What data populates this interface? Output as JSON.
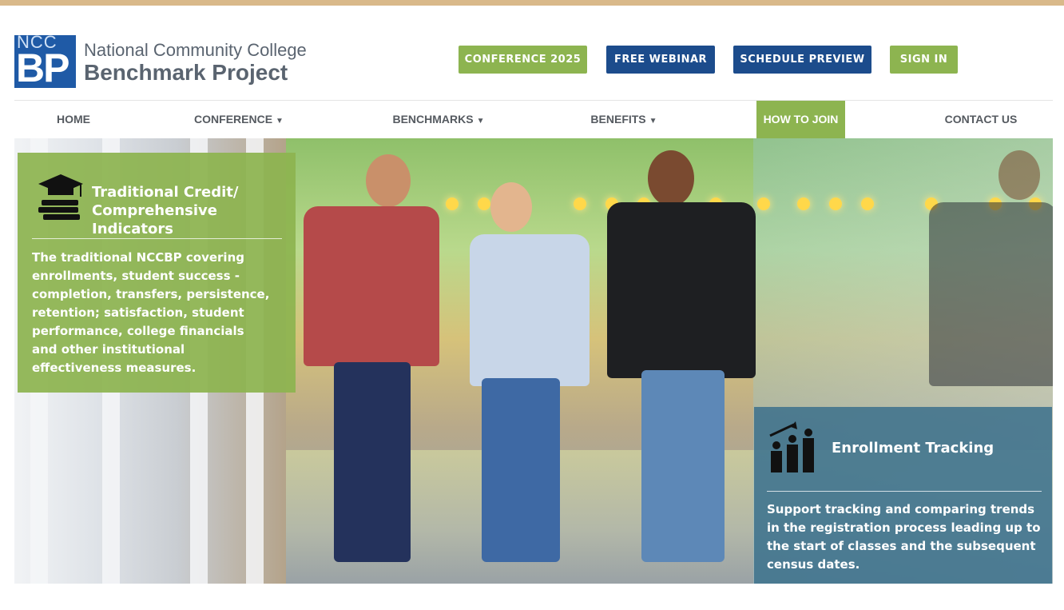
{
  "logo": {
    "mark_top": "NCC",
    "mark_bottom": "BP",
    "line1": "National Community College",
    "line2": "Benchmark Project"
  },
  "top_buttons": {
    "conference": "CONFERENCE 2025",
    "webinar": "FREE WEBINAR",
    "schedule": "SCHEDULE PREVIEW",
    "signin": "SIGN IN"
  },
  "nav": {
    "home": "HOME",
    "conference": "CONFERENCE",
    "benchmarks": "BENCHMARKS",
    "benefits": "BENEFITS",
    "how_to_join": "HOW TO JOIN",
    "contact": "CONTACT US"
  },
  "cards": {
    "left": {
      "icon": "graduation-cap-books-icon",
      "title_line1": "Traditional Credit/",
      "title_line2": "Comprehensive Indicators",
      "body": "The traditional NCCBP covering enrollments, student success - completion, transfers, persistence, retention; satisfaction, student performance, college financials and other institutional effectiveness measures."
    },
    "right": {
      "icon": "enrollment-growth-people-icon",
      "title": "Enrollment Tracking",
      "body": "Support tracking and comparing trends in the registration process leading up to the start of classes and the subsequent census dates."
    }
  },
  "colors": {
    "green": "#8db450",
    "blue": "#1c4c8c",
    "teal_card": "#3f728c",
    "top_strip": "#d9b98a"
  }
}
